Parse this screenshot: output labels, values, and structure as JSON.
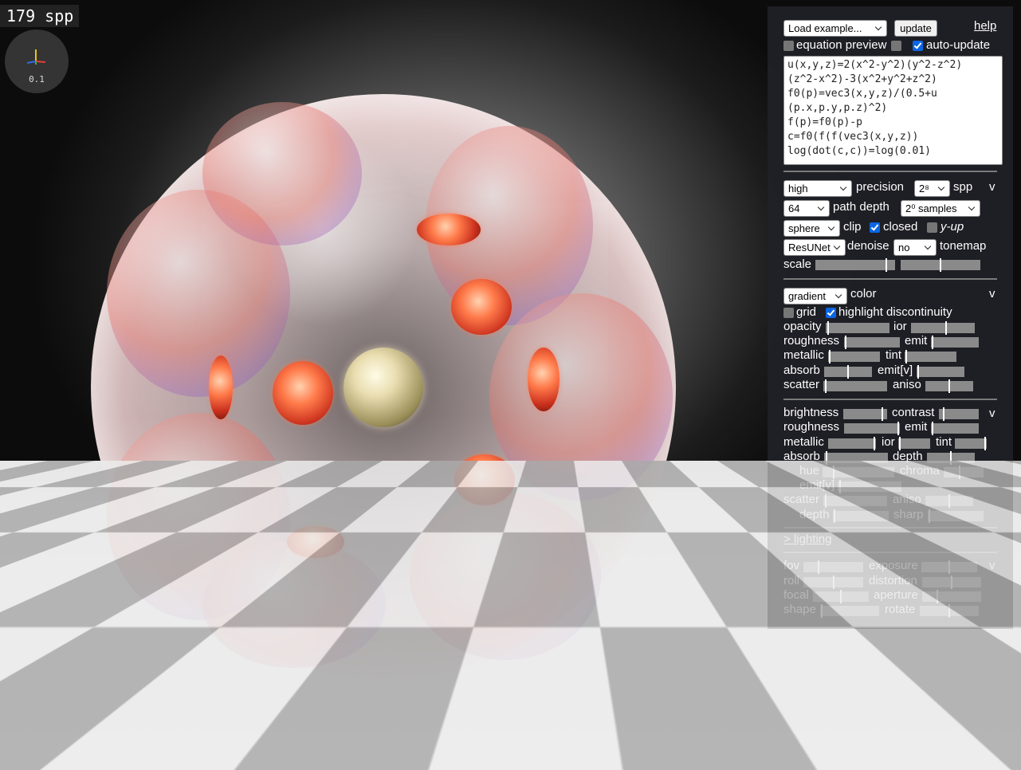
{
  "overlay": {
    "spp_counter": "179 spp",
    "axis_scale": "0.1"
  },
  "header": {
    "example_select": "Load example...",
    "update_button": "update",
    "help_link": "help"
  },
  "toggles": {
    "equation_preview": "equation preview",
    "auto_update": "auto-update",
    "equation_preview_checked": false,
    "extra_checked": false,
    "auto_update_checked": true
  },
  "equation": {
    "lines": [
      "u(x,y,z)=2(x^2-y^2)(y^2-z^2)",
      "(z^2-x^2)-3(x^2+y^2+z^2)",
      "f0(p)=vec3(x,y,z)/(0.5+u",
      "(p.x,p.y,p.z)^2)",
      "f(p)=f0(p)-p",
      "c=f0(f(f(vec3(x,y,z))",
      "log(dot(c,c))=log(0.01)"
    ]
  },
  "render": {
    "collapse": "v",
    "precision_value": "high",
    "precision_label": "precision",
    "spp_value": "2⁸",
    "spp_label": "spp",
    "path_depth_value": "64",
    "path_depth_label": "path depth",
    "samples_value": "2⁰ samples",
    "clip_value": "sphere",
    "clip_label": "clip",
    "closed_label": "closed",
    "closed_checked": true,
    "yup_label": "y-up",
    "yup_checked": false,
    "denoise_value": "ResUNet",
    "denoise_label": "denoise",
    "tonemap_value": "no",
    "tonemap_label": "tonemap",
    "scale_label": "scale",
    "scale_a": 0.9,
    "scale_b": 0.5
  },
  "material": {
    "collapse": "v",
    "color_mode": "gradient",
    "color_label": "color",
    "grid_label": "grid",
    "grid_checked": false,
    "highlight_label": "highlight discontinuity",
    "highlight_checked": true,
    "rows": [
      {
        "left": "opacity",
        "left_v": 0.02,
        "right": "ior",
        "right_v": 0.55
      },
      {
        "left": "roughness",
        "left_v": 0.02,
        "right": "emit",
        "right_v": 0.02
      },
      {
        "left": "metallic",
        "left_v": 0.02,
        "right": "tint",
        "right_v": 0.02
      },
      {
        "left": "absorb",
        "left_v": 0.5,
        "right": "emit[v]",
        "right_v": 0.02
      },
      {
        "left": "scatter",
        "left_v": 0.02,
        "right": "aniso",
        "right_v": 0.5
      }
    ]
  },
  "global": {
    "collapse": "v",
    "brightness_label": "brightness",
    "brightness_v": 0.9,
    "contrast_label": "contrast",
    "contrast_v": 0.1,
    "roughness_label": "roughness",
    "roughness_v": 0.98,
    "emit_label": "emit",
    "emit_v": 0.02,
    "metallic_label": "metallic",
    "metallic_v": 0.98,
    "ior_label": "ior",
    "ior_v": 0.02,
    "tint_label": "tint",
    "tint_v": 0.98,
    "absorb_label": "absorb",
    "absorb_v": 0.02,
    "depth_label": "depth",
    "depth_v": 0.5,
    "hue_label": "hue",
    "hue_v": 0.15,
    "chroma_label": "chroma",
    "chroma_v": 0.4,
    "emitv_label": "emit[v]",
    "emitv_v": 0.02,
    "scatter_label": "scatter",
    "scatter_v": 0.02,
    "aniso_label": "aniso",
    "aniso_v": 0.5,
    "depth2_label": "depth",
    "depth2_v": 0.02,
    "sharp_label": "sharp",
    "sharp_v": 0.02
  },
  "lighting_link": "> lighting",
  "camera": {
    "collapse": "v",
    "fov_label": "fov",
    "fov_v": 0.25,
    "exposure_label": "exposure",
    "exposure_v": 0.5,
    "roll_label": "roll",
    "roll_v": 0.5,
    "distortion_label": "distortion",
    "distortion_v": 0.5,
    "focal_label": "focal",
    "focal_v": 0.5,
    "aperture_label": "aperture",
    "aperture_v": 0.25,
    "shape_label": "shape",
    "shape_v": 0.02,
    "rotate_label": "rotate",
    "rotate_v": 0.5
  }
}
